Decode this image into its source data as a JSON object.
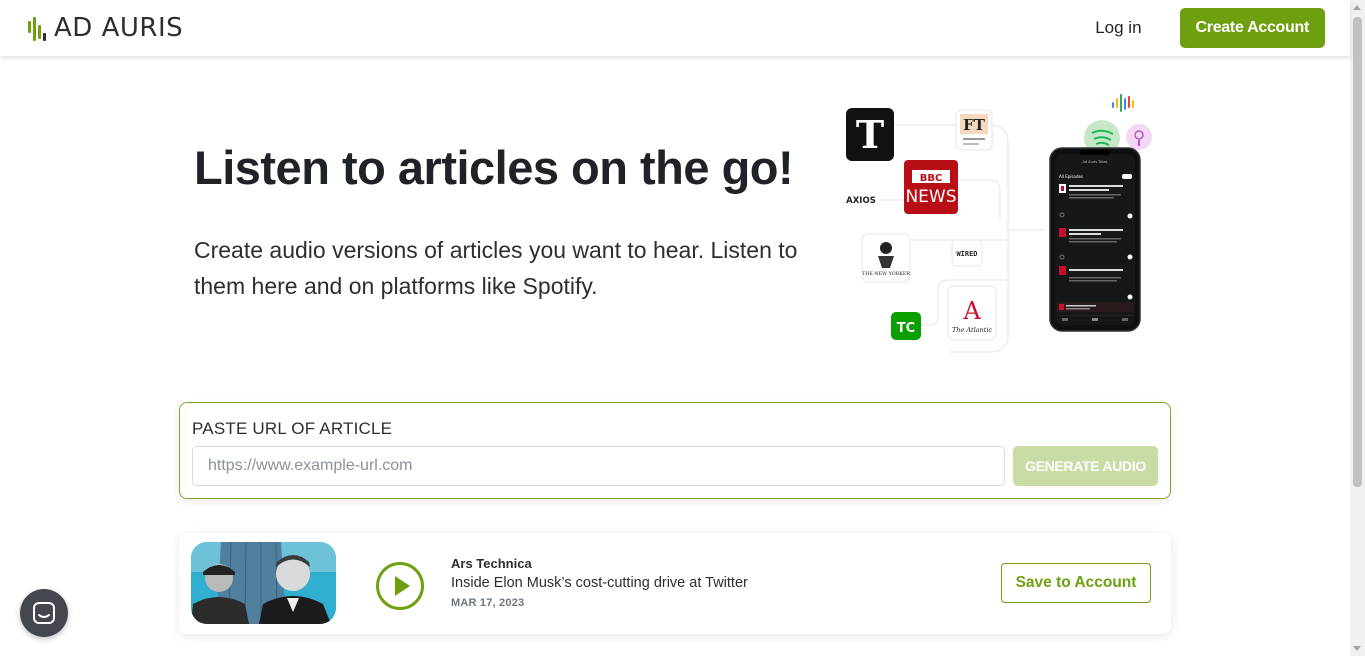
{
  "header": {
    "brand": "AD AURIS",
    "login_label": "Log in",
    "create_account_label": "Create Account"
  },
  "hero": {
    "title": "Listen to articles on the go!",
    "subtitle": "Create audio versions of articles you want to hear. Listen to them here and on platforms like Spotify."
  },
  "illustration": {
    "publisher_logos": [
      "T",
      "FT",
      "BBC",
      "NEWS",
      "AXIOS",
      "THE NEW YORKER",
      "WIRED",
      "TC",
      "A",
      "The Atlantic"
    ],
    "phone_header": "Ad Auris Titles",
    "phone_list_title": "All Episodes"
  },
  "url_form": {
    "label": "PASTE URL OF ARTICLE",
    "placeholder": "https://www.example-url.com",
    "value": "",
    "generate_label": "GENERATE AUDIO"
  },
  "article": {
    "source": "Ars Technica",
    "title": "Inside Elon Musk’s cost-cutting drive at Twitter",
    "date": "MAR 17, 2023",
    "save_label": "Save to Account"
  },
  "colors": {
    "brand_green": "#6e9f0f",
    "disabled_green": "#c9dca6",
    "text_dark": "#1f2328"
  },
  "icons": {
    "play": "play-icon",
    "chat": "chat-icon"
  }
}
